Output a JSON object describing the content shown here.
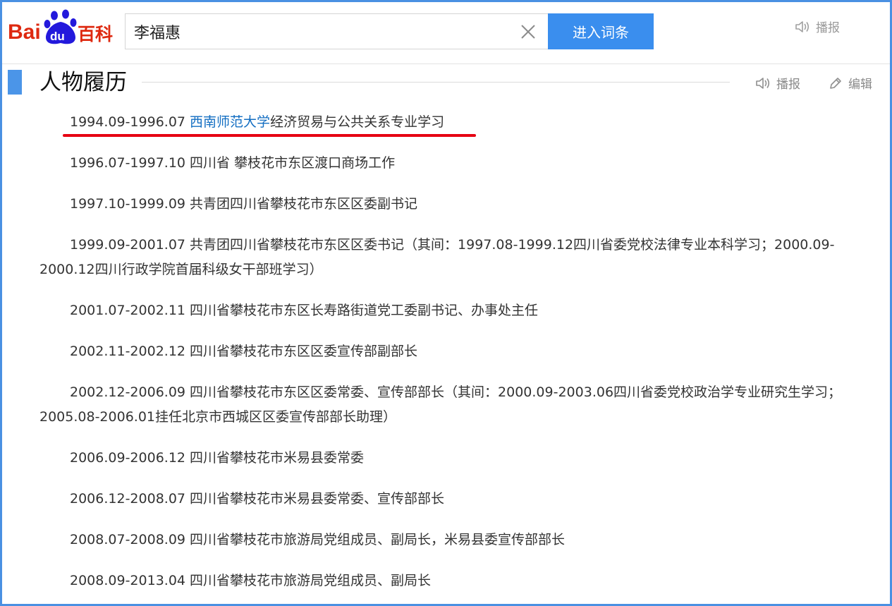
{
  "header": {
    "logo": {
      "bai": "Bai",
      "du": "du",
      "baike": "百科"
    },
    "search": {
      "value": "李福惠",
      "placeholder": ""
    },
    "enter_button": "进入词条",
    "broadcast": "播报"
  },
  "section": {
    "title": "人物履历",
    "broadcast": "播报",
    "edit": "编辑"
  },
  "colors": {
    "accent": "#3a8eee",
    "frame": "#4a90e2",
    "link": "#136ec2",
    "highlight": "#e60012"
  },
  "entries": [
    {
      "before": "1994.09-1996.07 ",
      "link": "西南师范大学",
      "after": "经济贸易与公共关系专业学习"
    },
    {
      "text": "1996.07-1997.10 四川省 攀枝花市东区渡口商场工作"
    },
    {
      "text": "1997.10-1999.09 共青团四川省攀枝花市东区区委副书记"
    },
    {
      "text": "1999.09-2001.07 共青团四川省攀枝花市东区区委书记（其间：1997.08-1999.12四川省委党校法律专业本科学习；2000.09-2000.12四川行政学院首届科级女干部班学习）"
    },
    {
      "text": "2001.07-2002.11 四川省攀枝花市东区长寿路街道党工委副书记、办事处主任"
    },
    {
      "text": "2002.11-2002.12 四川省攀枝花市东区区委宣传部副部长"
    },
    {
      "text": "2002.12-2006.09 四川省攀枝花市东区区委常委、宣传部部长（其间：2000.09-2003.06四川省委党校政治学专业研究生学习；2005.08-2006.01挂任北京市西城区区委宣传部部长助理）"
    },
    {
      "text": "2006.09-2006.12 四川省攀枝花市米易县委常委"
    },
    {
      "text": "2006.12-2008.07 四川省攀枝花市米易县委常委、宣传部部长"
    },
    {
      "text": "2008.07-2008.09 四川省攀枝花市旅游局党组成员、副局长，米易县委宣传部部长"
    },
    {
      "text": "2008.09-2013.04 四川省攀枝花市旅游局党组成员、副局长"
    }
  ]
}
